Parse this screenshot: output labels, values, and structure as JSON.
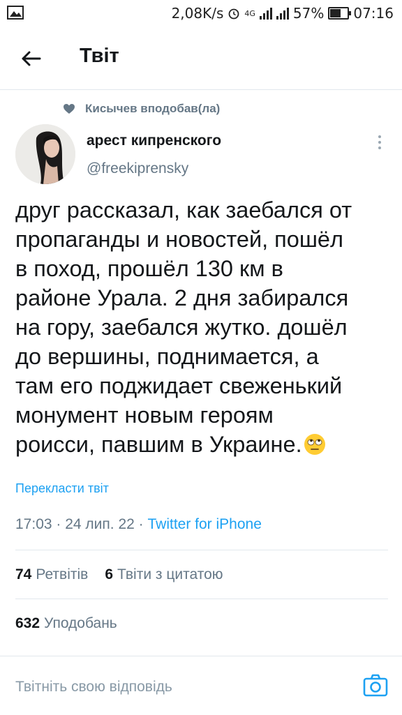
{
  "status_bar": {
    "speed": "2,08K/s",
    "network": "4G",
    "battery": "57%",
    "time": "07:16"
  },
  "header": {
    "title": "Твіт"
  },
  "liked_by": "Кисычев вподобав(ла)",
  "author": {
    "name": "арест кипренского",
    "handle": "@freekiprensky"
  },
  "tweet": {
    "lines": [
      "друг рассказал, как заебался от",
      "пропаганды и новостей, пошёл",
      "в поход, прошёл 130 км в",
      "районе Урала. 2 дня забирался",
      "на гору, заебался жутко. дошёл",
      "до вершины, поднимается, а",
      "там его поджидает свеженький",
      "монумент новым героям",
      "роисси, павшим в Украине."
    ],
    "translate": "Перекласти твіт",
    "time": "17:03",
    "date": "24 лип. 22",
    "source": "Twitter for iPhone"
  },
  "stats": {
    "retweets_count": "74",
    "retweets_label": "Ретвітів",
    "quotes_count": "6",
    "quotes_label": "Твіти з цитатою",
    "likes_count": "632",
    "likes_label": "Уподобань"
  },
  "reply": {
    "placeholder": "Твітніть свою відповідь"
  },
  "colors": {
    "accent": "#1da1f2",
    "secondary_text": "#657786",
    "divider": "#e1e8ed"
  },
  "icons": [
    "image-icon",
    "alarm-icon",
    "signal-icon",
    "battery-icon",
    "back-arrow-icon",
    "heart-icon",
    "more-icon",
    "eye-roll-emoji",
    "camera-icon"
  ]
}
